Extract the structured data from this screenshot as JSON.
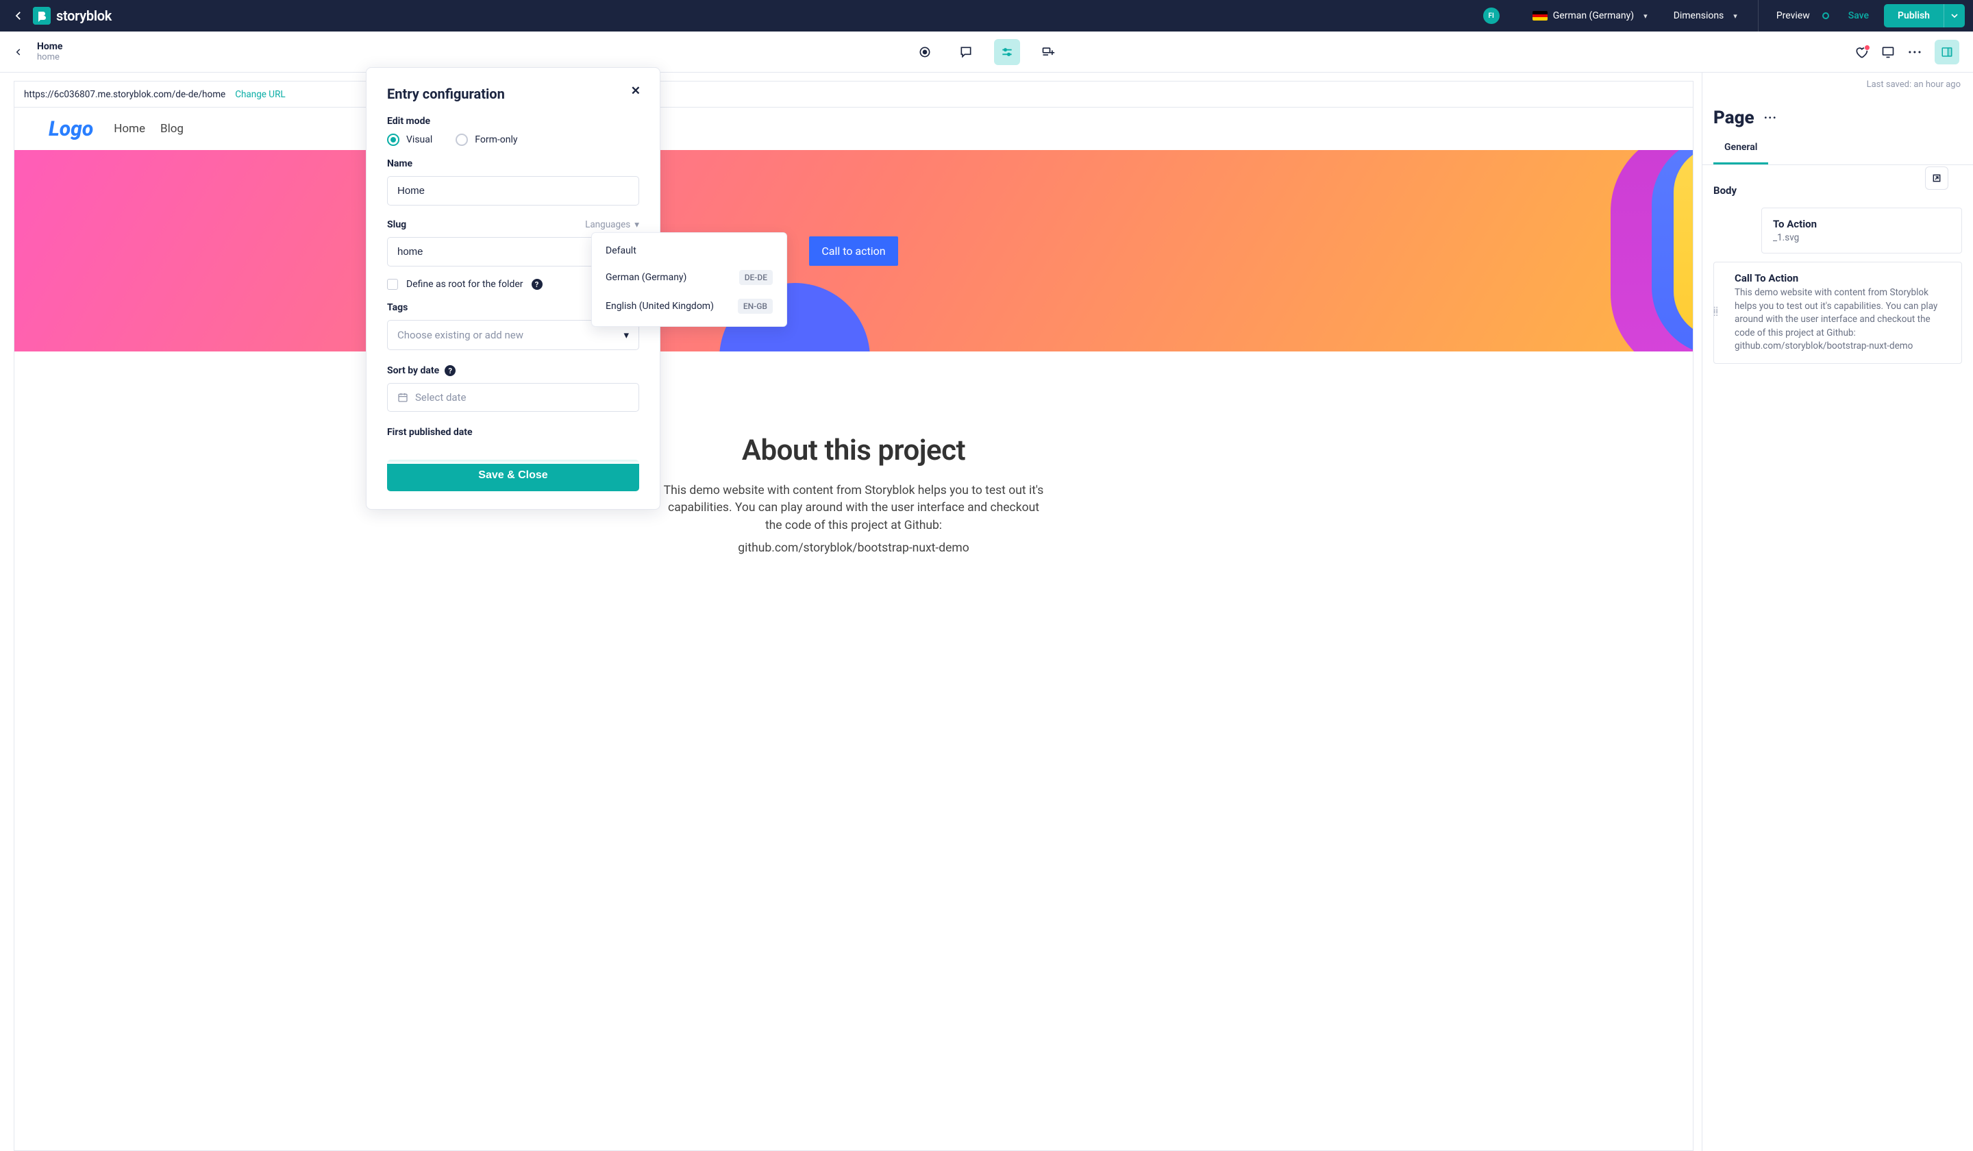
{
  "top_nav": {
    "avatar_initials": "FI",
    "language_label": "German (Germany)",
    "dimensions_label": "Dimensions",
    "preview_label": "Preview",
    "save_label": "Save",
    "publish_label": "Publish",
    "brand": "storyblok"
  },
  "sub_nav": {
    "title": "Home",
    "subtitle": "home"
  },
  "preview": {
    "url": "https://6c036807.me.storyblok.com/de-de/home",
    "change_url_label": "Change URL",
    "logo": "Logo",
    "nav_home": "Home",
    "nav_blog": "Blog",
    "cta": "Call to action",
    "about_heading": "About this project",
    "about_p1": "This demo website with content from Storyblok helps you to test out it's capabilities. You can play around with the user interface and checkout the code of this project at Github:",
    "about_p2": "github.com/storyblok/bootstrap-nuxt-demo"
  },
  "sidebar": {
    "last_saved": "Last saved: an hour ago",
    "page_title": "Page",
    "tab_general": "General",
    "body_label": "Body",
    "block1": {
      "title": "To Action",
      "subtitle": "_1.svg"
    },
    "block2": {
      "title": "Call To Action",
      "desc": "This demo website with content from Storyblok helps you to test out it's capabilities. You can play around with the user interface and checkout the code of this project at Github: github.com/storyblok/bootstrap-nuxt-demo"
    }
  },
  "modal": {
    "title": "Entry configuration",
    "edit_mode_label": "Edit mode",
    "visual_label": "Visual",
    "form_only_label": "Form-only",
    "name_label": "Name",
    "name_value": "Home",
    "slug_label": "Slug",
    "slug_value": "home",
    "languages_label": "Languages",
    "define_root_label": "Define as root for the folder",
    "tags_label": "Tags",
    "tags_placeholder": "Choose existing or add new",
    "sort_label": "Sort by date",
    "date_placeholder": "Select date",
    "first_published_label": "First published date",
    "save_close": "Save & Close"
  },
  "dropdown": {
    "default_label": "Default",
    "german_label": "German (Germany)",
    "german_code": "DE-DE",
    "english_label": "English (United Kingdom)",
    "english_code": "EN-GB"
  }
}
